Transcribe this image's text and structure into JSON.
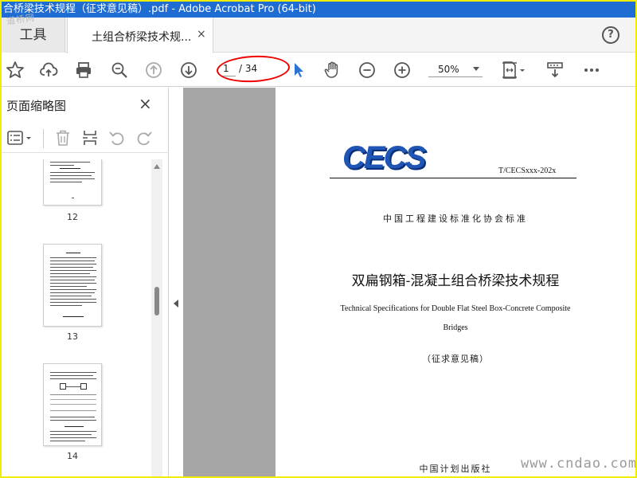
{
  "window": {
    "title": "合桥梁技术规程（征求意见稿）.pdf - Adobe Acrobat Pro (64-bit)"
  },
  "tabs": {
    "tools_label": "工具",
    "doc_label": "土组合桥梁技术规...",
    "close_glyph": "×",
    "help_glyph": "?"
  },
  "watermark": {
    "top": "道桥网",
    "bottom": "www.cndao.com"
  },
  "toolbar": {
    "current_page": "1",
    "page_total": "/ 34",
    "zoom": "50%",
    "icons": [
      "star-icon",
      "upload-icon",
      "print-icon",
      "zoom-out-search-icon",
      "page-up-icon",
      "page-down-icon",
      "select-arrow-icon",
      "hand-icon",
      "zoom-out-icon",
      "zoom-in-icon",
      "fit-page-icon",
      "scroll-mode-icon",
      "more-icon"
    ]
  },
  "sidebar": {
    "title": "页面缩略图",
    "close_glyph": "×",
    "thumbnails": [
      {
        "label": "12"
      },
      {
        "label": "13"
      },
      {
        "label": "14"
      }
    ]
  },
  "document": {
    "logo": "CECS",
    "standard_no": "T/CECSxxx-202x",
    "association": "中国工程建设标准化协会标准",
    "title_cn": "双扁钢箱-混凝土组合桥梁技术规程",
    "title_en_line1": "Technical Specifications for Double Flat Steel Box-Concrete Composite",
    "title_en_line2": "Bridges",
    "draft_note": "（征求意见稿）",
    "publisher": "中国计划出版社"
  },
  "colors": {
    "titlebar": "#1f6dd3",
    "frame": "#f0ee00",
    "highlight_oval": "#e00000",
    "logo": "#1f55b5"
  }
}
